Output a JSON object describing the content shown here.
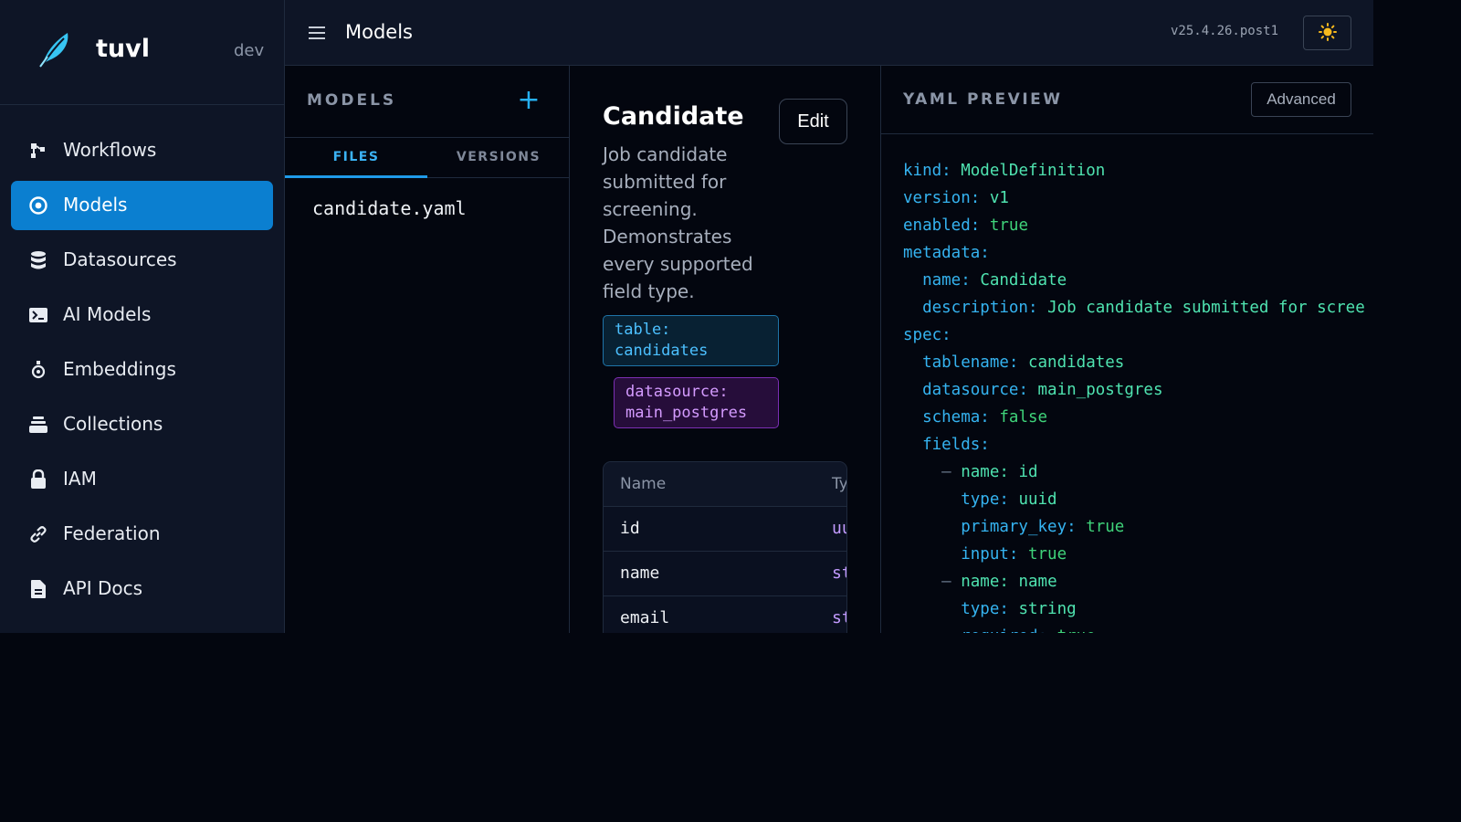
{
  "brand": {
    "name": "tuvl",
    "env": "dev"
  },
  "sidebar": {
    "items": [
      {
        "label": "Workflows",
        "icon": "workflows-icon"
      },
      {
        "label": "Models",
        "icon": "models-icon",
        "active": true
      },
      {
        "label": "Datasources",
        "icon": "database-icon"
      },
      {
        "label": "AI Models",
        "icon": "terminal-icon"
      },
      {
        "label": "Embeddings",
        "icon": "embeddings-icon"
      },
      {
        "label": "Collections",
        "icon": "collections-icon"
      },
      {
        "label": "IAM",
        "icon": "lock-icon"
      },
      {
        "label": "Federation",
        "icon": "link-icon"
      },
      {
        "label": "API Docs",
        "icon": "document-icon"
      }
    ]
  },
  "header": {
    "title": "Models",
    "version": "v25.4.26.post1",
    "theme_icon": "sun-icon"
  },
  "models_panel": {
    "title": "MODELS",
    "add_label": "+",
    "tabs": [
      {
        "label": "FILES",
        "active": true
      },
      {
        "label": "VERSIONS"
      }
    ],
    "files": [
      "candidate.yaml"
    ]
  },
  "detail": {
    "name": "Candidate",
    "edit_label": "Edit",
    "description": "Job candidate submitted for screening. Demonstrates every supported field type.",
    "table_tag": "table: candidates",
    "datasource_tag": "datasource: main_postgres",
    "fields_header": {
      "name": "Name",
      "type": "Ty"
    },
    "fields": [
      {
        "name": "id",
        "type": "uu"
      },
      {
        "name": "name",
        "type": "st"
      },
      {
        "name": "email",
        "type": "st"
      }
    ]
  },
  "yaml": {
    "title": "YAML PREVIEW",
    "advanced_label": "Advanced",
    "lines": [
      {
        "indent": "",
        "dash": "",
        "key": "kind",
        "value": "ModelDefinition",
        "type": "str"
      },
      {
        "indent": "",
        "dash": "",
        "key": "version",
        "value": "v1",
        "type": "str"
      },
      {
        "indent": "",
        "dash": "",
        "key": "enabled",
        "value": "true",
        "type": "bool"
      },
      {
        "indent": "",
        "dash": "",
        "key": "metadata",
        "value": "",
        "type": "str"
      },
      {
        "indent": "  ",
        "dash": "",
        "key": "name",
        "value": "Candidate",
        "type": "str"
      },
      {
        "indent": "  ",
        "dash": "",
        "key": "description",
        "value": "Job candidate submitted for scree",
        "type": "str"
      },
      {
        "indent": "",
        "dash": "",
        "key": "spec",
        "value": "",
        "type": "str"
      },
      {
        "indent": "  ",
        "dash": "",
        "key": "tablename",
        "value": "candidates",
        "type": "str"
      },
      {
        "indent": "  ",
        "dash": "",
        "key": "datasource",
        "value": "main_postgres",
        "type": "str"
      },
      {
        "indent": "  ",
        "dash": "",
        "key": "schema",
        "value": "false",
        "type": "bool"
      },
      {
        "indent": "  ",
        "dash": "",
        "key": "fields",
        "value": "",
        "type": "str"
      },
      {
        "indent": "    ",
        "dash": "– ",
        "key": "name",
        "value": "id",
        "type": "str"
      },
      {
        "indent": "      ",
        "dash": "",
        "key": "type",
        "value": "uuid",
        "type": "str"
      },
      {
        "indent": "      ",
        "dash": "",
        "key": "primary_key",
        "value": "true",
        "type": "bool"
      },
      {
        "indent": "      ",
        "dash": "",
        "key": "input",
        "value": "true",
        "type": "bool"
      },
      {
        "indent": "    ",
        "dash": "– ",
        "key": "name",
        "value": "name",
        "type": "str"
      },
      {
        "indent": "      ",
        "dash": "",
        "key": "type",
        "value": "string",
        "type": "str"
      },
      {
        "indent": "      ",
        "dash": "",
        "key": "required",
        "value": "true",
        "type": "bool"
      }
    ]
  },
  "colors": {
    "accent": "#0b7fd0",
    "sidebar_bg": "#0e1526",
    "yaml_key": "#35b3f0",
    "yaml_value": "#4fe3b0"
  }
}
